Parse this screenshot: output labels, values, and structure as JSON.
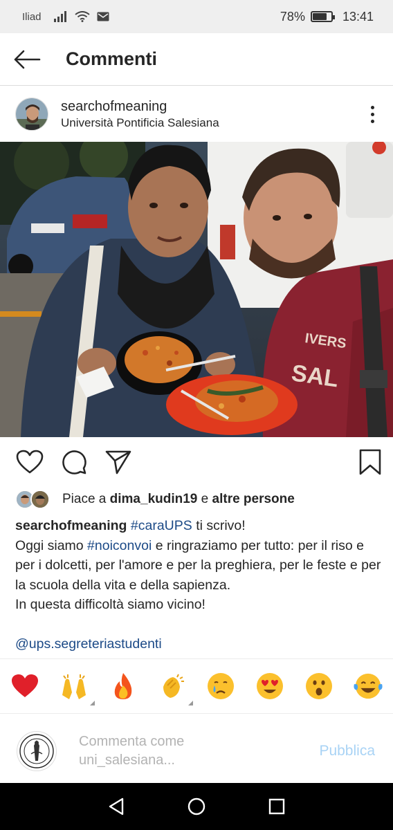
{
  "status_bar": {
    "carrier": "Iliad",
    "battery": "78%",
    "battery_level": 0.78,
    "time": "13:41"
  },
  "header": {
    "title": "Commenti"
  },
  "post": {
    "username": "searchofmeaning",
    "location": "Università Pontificia Salesiana",
    "likes": {
      "prefix": "Piace a",
      "user": "dima_kudin19",
      "connector": "e",
      "rest": "altre persone"
    },
    "caption": {
      "username": "searchofmeaning",
      "hashtag1": "#caraUPS",
      "text1": "ti scrivo!",
      "line2_prefix": "Oggi siamo",
      "hashtag2": "#noiconvoi",
      "line2_rest": "e ringraziamo per tutto: per il riso e per i dolcetti, per l'amore e per la preghiera, per le feste e per la scuola della vita e della sapienza.",
      "line3": "In questa difficoltà siamo vicino!",
      "mention": "@ups.segreteriastudenti"
    }
  },
  "emoji_bar": [
    {
      "name": "red-heart-emoji",
      "glyph": "❤️"
    },
    {
      "name": "raising-hands-emoji",
      "glyph": "🙌"
    },
    {
      "name": "fire-emoji",
      "glyph": "🔥"
    },
    {
      "name": "clapping-hands-emoji",
      "glyph": "👏"
    },
    {
      "name": "crying-face-emoji",
      "glyph": "😢"
    },
    {
      "name": "heart-eyes-emoji",
      "glyph": "😍"
    },
    {
      "name": "surprised-face-emoji",
      "glyph": "😮"
    },
    {
      "name": "tears-of-joy-emoji",
      "glyph": "😂"
    }
  ],
  "comment": {
    "placeholder": "Commenta come uni_salesiana...",
    "publish_label": "Pubblica"
  },
  "colors": {
    "hashtag": "#1c4a87",
    "publish": "#a9d3f5",
    "status_bar_bg": "#efefef",
    "nav_bar_bg": "#000000"
  }
}
